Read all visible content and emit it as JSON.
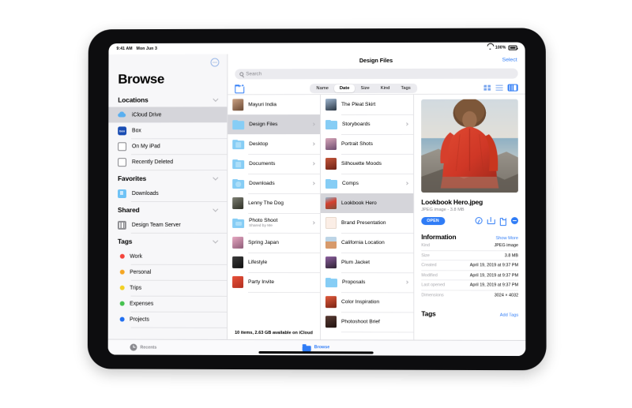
{
  "status_bar": {
    "time": "9:41 AM",
    "date": "Mon Jun 3",
    "wifi_icon": "wifi-icon",
    "battery_percent": "100%",
    "battery_icon": "battery-icon"
  },
  "sidebar": {
    "title": "Browse",
    "more_button_icon": "ellipsis-circle-icon",
    "sections": [
      {
        "header": "Locations",
        "chevron_icon": "chevron-down-icon",
        "items": [
          {
            "label": "iCloud Drive",
            "icon": "icloud-icon",
            "selected": true
          },
          {
            "label": "Box",
            "icon": "box-icon",
            "selected": false
          },
          {
            "label": "On My iPad",
            "icon": "ipad-icon",
            "selected": false
          },
          {
            "label": "Recently Deleted",
            "icon": "trash-icon",
            "selected": false
          }
        ]
      },
      {
        "header": "Favorites",
        "chevron_icon": "chevron-down-icon",
        "items": [
          {
            "label": "Downloads",
            "icon": "downloads-folder-icon",
            "selected": false
          }
        ]
      },
      {
        "header": "Shared",
        "chevron_icon": "chevron-down-icon",
        "items": [
          {
            "label": "Design Team Server",
            "icon": "server-icon",
            "selected": false
          }
        ]
      },
      {
        "header": "Tags",
        "chevron_icon": "chevron-down-icon",
        "tags": [
          {
            "label": "Work",
            "color": "#f4433a"
          },
          {
            "label": "Personal",
            "color": "#f5a623"
          },
          {
            "label": "Trips",
            "color": "#f2d024"
          },
          {
            "label": "Expenses",
            "color": "#45c14f"
          },
          {
            "label": "Projects",
            "color": "#1f6ef0"
          }
        ]
      }
    ]
  },
  "navbar": {
    "title": "Design Files",
    "select_label": "Select"
  },
  "search": {
    "placeholder": "Search",
    "icon": "search-icon"
  },
  "sortbar": {
    "new_folder_icon": "new-folder-icon",
    "segments": [
      {
        "label": "Name",
        "selected": false
      },
      {
        "label": "Date",
        "selected": true
      },
      {
        "label": "Size",
        "selected": false
      },
      {
        "label": "Kind",
        "selected": false
      },
      {
        "label": "Tags",
        "selected": false
      }
    ],
    "views": [
      {
        "name": "grid-view-icon",
        "selected": false
      },
      {
        "name": "list-view-icon",
        "selected": false
      },
      {
        "name": "column-view-icon",
        "selected": true
      }
    ]
  },
  "column1": {
    "items": [
      {
        "label": "Mayuri India",
        "type": "photo",
        "chevron": false,
        "selected": false,
        "c1": "#caa183",
        "c2": "#6b4a35"
      },
      {
        "label": "Design Files",
        "type": "folder",
        "glyph": "plain",
        "chevron": true,
        "selected": true
      },
      {
        "label": "Desktop",
        "type": "folder",
        "glyph": "desktop",
        "chevron": true,
        "selected": false
      },
      {
        "label": "Documents",
        "type": "folder",
        "glyph": "document",
        "chevron": true,
        "selected": false
      },
      {
        "label": "Downloads",
        "type": "folder",
        "glyph": "download",
        "chevron": true,
        "selected": false
      },
      {
        "label": "Lenny The Dog",
        "type": "photo",
        "chevron": false,
        "selected": false,
        "c1": "#7d7f74",
        "c2": "#2e3026"
      },
      {
        "label": "Photo Shoot",
        "sub": "Shared by Me",
        "type": "folder",
        "glyph": "shared",
        "chevron": true,
        "selected": false
      },
      {
        "label": "Spring Japan",
        "type": "photo",
        "chevron": false,
        "selected": false,
        "c1": "#e7a8c2",
        "c2": "#8e5c78"
      },
      {
        "label": "Lifestyle",
        "type": "photo",
        "chevron": false,
        "selected": false,
        "c1": "#3b3b3b",
        "c2": "#101010"
      },
      {
        "label": "Party Invite",
        "type": "photo",
        "chevron": false,
        "selected": false,
        "c1": "#e8513a",
        "c2": "#b12f1f"
      }
    ],
    "footer": "10 items, 2.63 GB available on iCloud"
  },
  "column2": {
    "items": [
      {
        "label": "The Pleat Skirt",
        "type": "photo",
        "chevron": false,
        "selected": false,
        "c1": "#9fb6cf",
        "c2": "#2b3744"
      },
      {
        "label": "Storyboards",
        "type": "folder",
        "glyph": "plain",
        "chevron": true,
        "selected": false
      },
      {
        "label": "Portrait Shots",
        "type": "photo",
        "chevron": false,
        "selected": false,
        "c1": "#d7a6b9",
        "c2": "#6d4d70"
      },
      {
        "label": "Silhouette Moods",
        "type": "photo",
        "chevron": false,
        "selected": false,
        "c1": "#c4563a",
        "c2": "#6e2216"
      },
      {
        "label": "Comps",
        "type": "folder",
        "glyph": "plain",
        "chevron": true,
        "selected": false
      },
      {
        "label": "Lookbook Hero",
        "type": "photo",
        "chevron": false,
        "selected": true,
        "c1": "#d4402f",
        "c2": "#7e4f3a"
      },
      {
        "label": "Brand Presentation",
        "type": "doc",
        "chevron": false,
        "selected": false
      },
      {
        "label": "California Location",
        "type": "photo",
        "chevron": false,
        "selected": false,
        "c1": "#d79a6b",
        "c2": "#5a4434"
      },
      {
        "label": "Plum Jacket",
        "type": "photo",
        "chevron": false,
        "selected": false,
        "c1": "#8b5e9e",
        "c2": "#2f2433"
      },
      {
        "label": "Proposals",
        "type": "folder",
        "glyph": "plain",
        "chevron": true,
        "selected": false
      },
      {
        "label": "Color Inspiration",
        "type": "photo",
        "chevron": false,
        "selected": false,
        "c1": "#e05a3c",
        "c2": "#7a2414"
      },
      {
        "label": "Photoshoot Brief",
        "type": "photo",
        "chevron": false,
        "selected": false,
        "c1": "#5a3b33",
        "c2": "#201310"
      }
    ]
  },
  "info_panel": {
    "preview_image_alt": "woman-in-red-dress-on-beach",
    "file_name": "Lookbook Hero.jpeg",
    "file_meta": "JPEG image - 3.8 MB",
    "open_button": "OPEN",
    "action_icons": [
      "markup-icon",
      "share-icon",
      "duplicate-icon",
      "more-icon"
    ],
    "information": {
      "title": "Information",
      "link": "Show More",
      "rows": [
        {
          "key": "Kind",
          "value": "JPEG image"
        },
        {
          "key": "Size",
          "value": "3.8 MB"
        },
        {
          "key": "Created",
          "value": "April 19, 2019 at 9:37 PM"
        },
        {
          "key": "Modified",
          "value": "April 19, 2019 at 9:37 PM"
        },
        {
          "key": "Last opened",
          "value": "April 19, 2019 at 9:37 PM"
        },
        {
          "key": "Dimensions",
          "value": "3024 × 4032"
        }
      ]
    },
    "tags": {
      "title": "Tags",
      "link": "Add Tags"
    }
  },
  "tab_bar": {
    "tabs": [
      {
        "label": "Recents",
        "icon": "clock-icon",
        "selected": false
      },
      {
        "label": "Browse",
        "icon": "folder-icon",
        "selected": true
      }
    ]
  },
  "colors": {
    "accent": "#2f7cf6",
    "selection": "#d5d5da",
    "sidebar_bg": "#f7f7f9"
  }
}
